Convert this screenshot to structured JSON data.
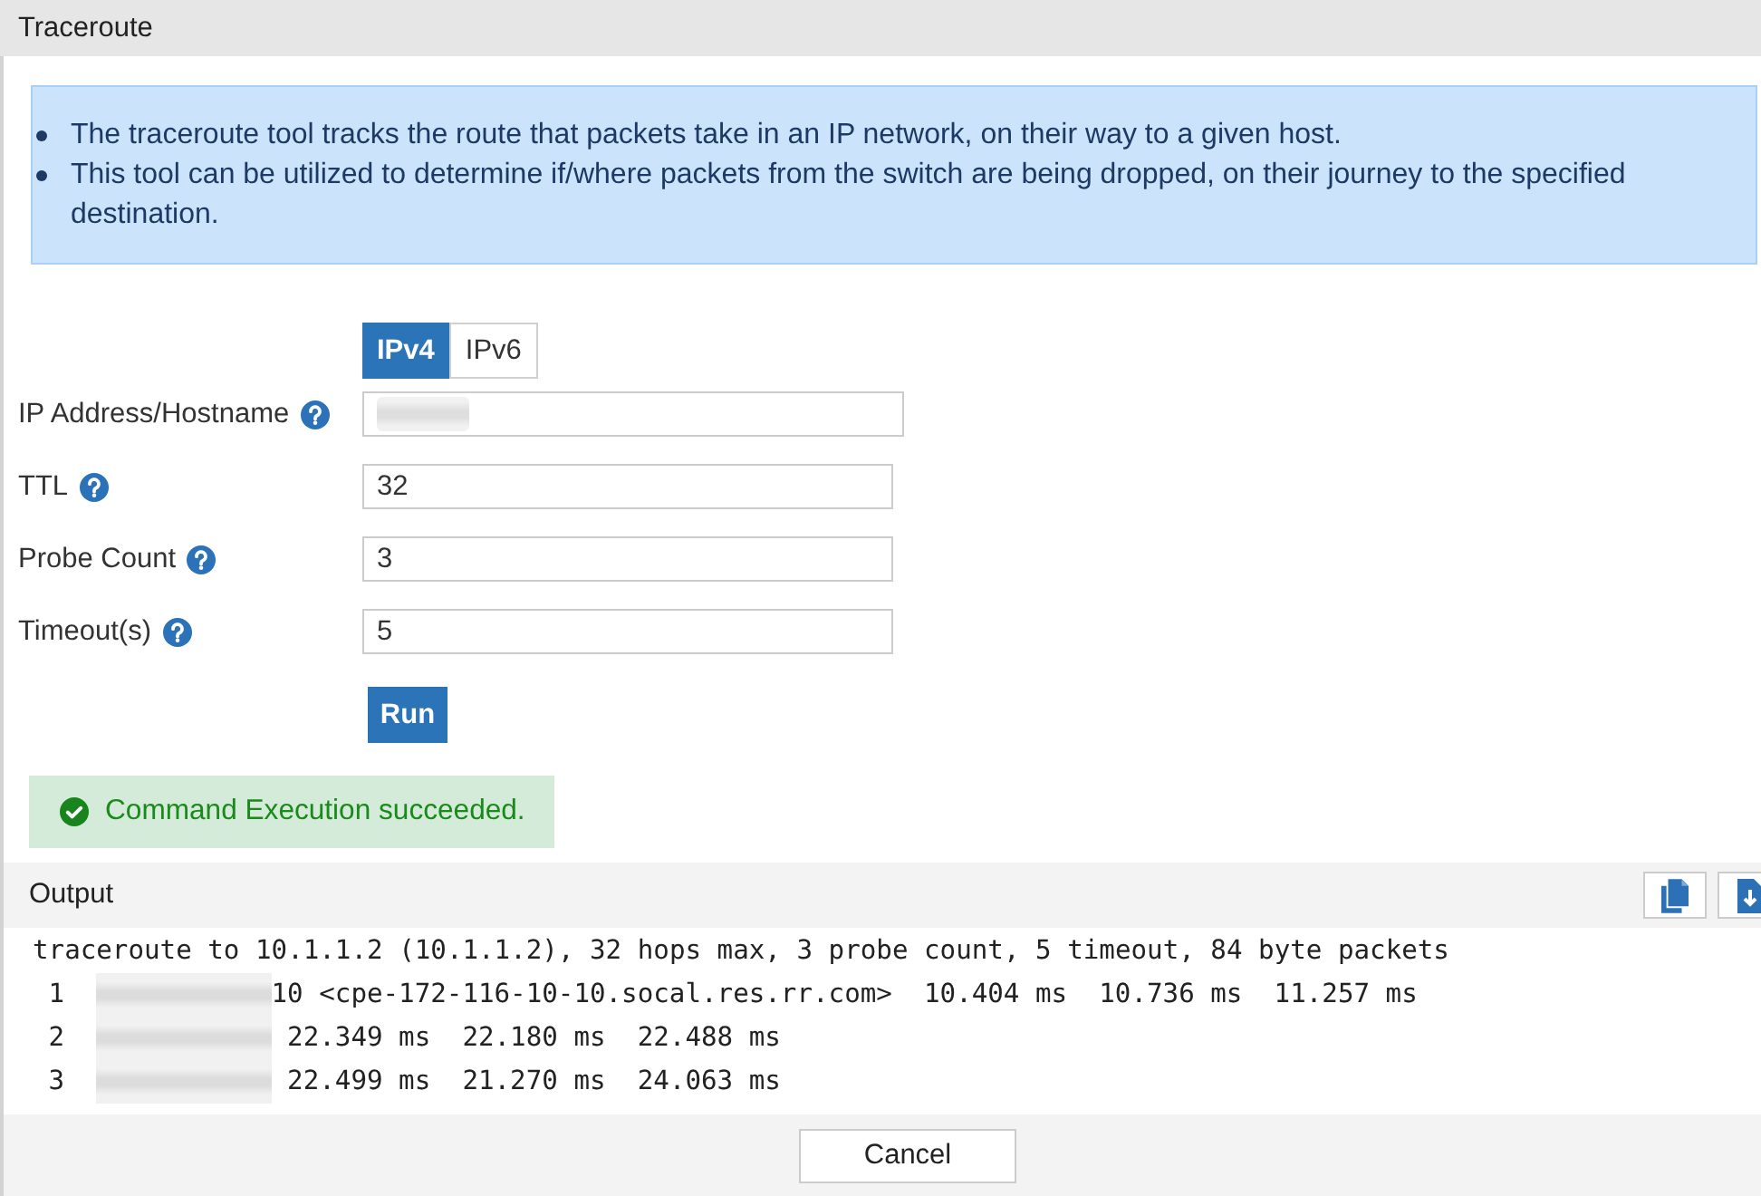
{
  "window": {
    "title": "Traceroute"
  },
  "info": {
    "bullets": [
      "The traceroute tool tracks the route that packets take in an IP network, on their way to a given host.",
      "This tool can be utilized to determine if/where packets from the switch are being dropped, on their journey to the specified destination."
    ]
  },
  "ip_version": [
    {
      "label": "IPv4",
      "selected": true
    },
    {
      "label": "IPv6",
      "selected": false
    }
  ],
  "fields": [
    {
      "label": "IP Address/Hostname",
      "redacted": true
    },
    {
      "label": "TTL",
      "value": "32"
    },
    {
      "label": "Probe Count",
      "value": "3"
    },
    {
      "label": "Timeout(s)",
      "value": "5"
    }
  ],
  "run_button": "Run",
  "alert": {
    "kind": "success",
    "text": "Command Execution succeeded."
  },
  "output": {
    "title": "Output",
    "command_line": "traceroute to 10.1.1.2 (10.1.1.2), 32 hops max, 3 probe count, 5 timeout, 84 byte packets",
    "hops": [
      {
        "number": "1",
        "redacted": true,
        "host": "10 <cpe-172-116-10-10.socal.res.rr.com>",
        "times": "10.404 ms  10.736 ms  11.257 ms"
      },
      {
        "number": "2",
        "redacted": true,
        "times": "22.349 ms  22.180 ms  22.488 ms"
      },
      {
        "number": "3",
        "redacted": true,
        "times": "22.499 ms  21.270 ms  24.063 ms"
      }
    ]
  },
  "footer": {
    "cancel_button": "Cancel"
  }
}
